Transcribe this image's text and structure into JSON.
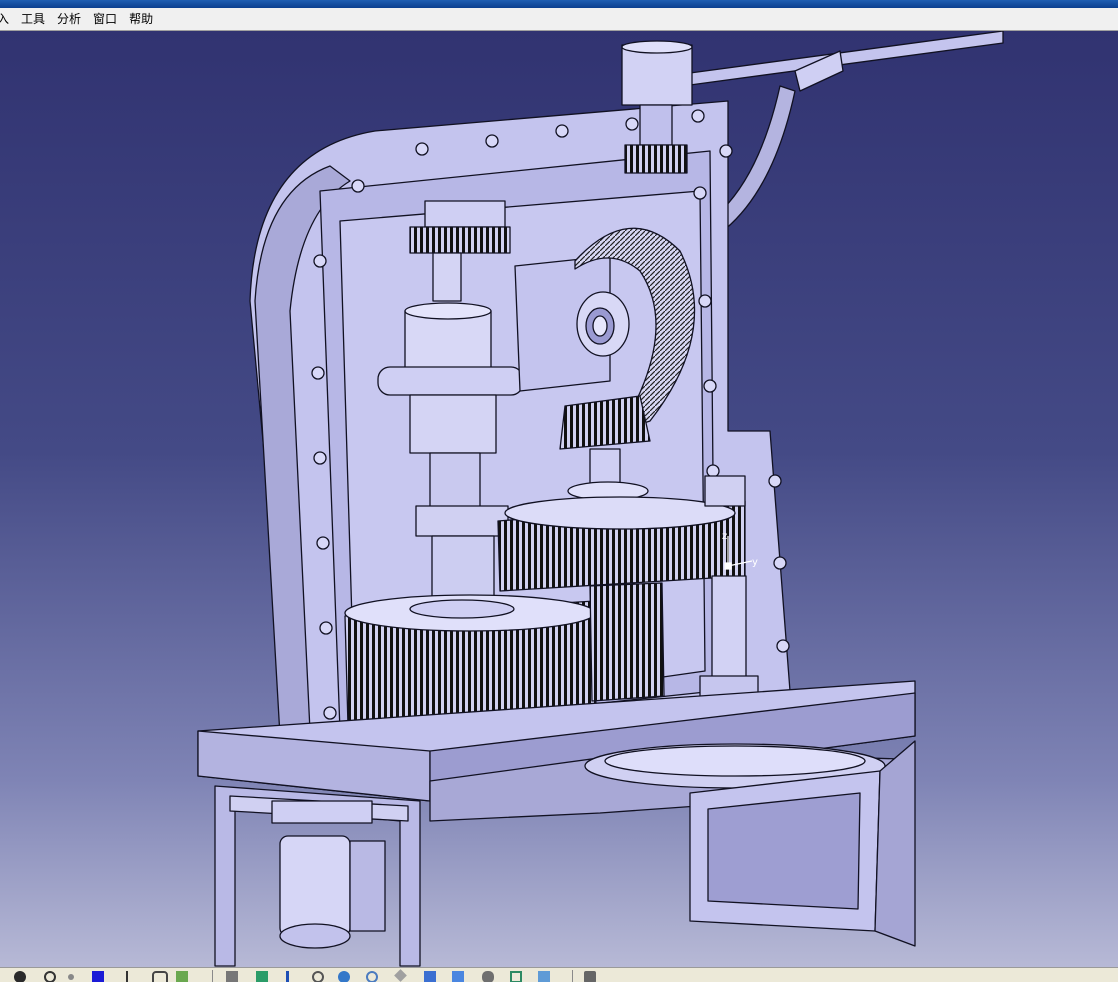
{
  "app": {
    "menu": [
      {
        "id": "start-partial",
        "label": "入"
      },
      {
        "id": "tools",
        "label": "工具"
      },
      {
        "id": "analysis",
        "label": "分析"
      },
      {
        "id": "window",
        "label": "窗口"
      },
      {
        "id": "help",
        "label": "帮助"
      }
    ]
  },
  "viewport": {
    "background_top": "#313371",
    "background_bottom": "#b7b9d6",
    "model_color": "#c4c4ee",
    "edge_color": "#111122",
    "compass": {
      "z_label": "z",
      "y_label": "y"
    }
  },
  "toolbar_icons": [
    "undo-icon",
    "search-icon",
    "dot-icon",
    "blue-square-icon",
    "arrow-icon",
    "clip-icon",
    "doc-icon",
    "cut-icon",
    "table-icon",
    "vertical-arrow-icon",
    "link-icon",
    "globe-icon",
    "zoom-icon",
    "shape-icon",
    "cube-icon",
    "cube2-icon",
    "cylinder-icon",
    "frame-icon",
    "window-icon",
    "camera-icon"
  ]
}
